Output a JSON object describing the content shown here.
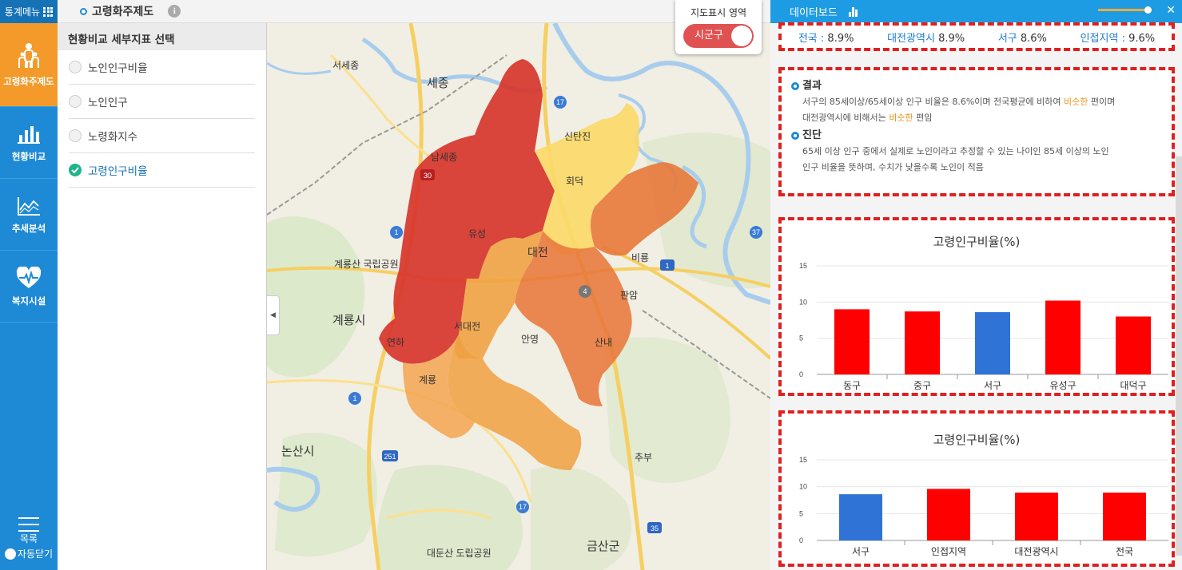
{
  "left_menu": {
    "menu_label": "통계메뉴",
    "items": [
      {
        "label": "고령화주제도",
        "icon": "people-icon",
        "active": true
      },
      {
        "label": "현황비교",
        "icon": "bar-chart-icon",
        "active": false
      },
      {
        "label": "추세분석",
        "icon": "line-chart-icon",
        "active": false
      },
      {
        "label": "복지시설",
        "icon": "heart-pulse-icon",
        "active": false
      }
    ],
    "list_label": "목록",
    "auto_close_label": "자동닫기"
  },
  "topbar": {
    "title": "고령화주제도",
    "info_icon": "i"
  },
  "indicator_panel": {
    "heading": "현황비교 세부지표 선택",
    "options": [
      {
        "label": "노인인구비율",
        "selected": false
      },
      {
        "label": "노인인구",
        "selected": false
      },
      {
        "label": "노령화지수",
        "selected": false
      },
      {
        "label": "고령인구비율",
        "selected": true
      }
    ]
  },
  "map": {
    "toggle_title": "지도표시 영역",
    "toggle_value": "시군구",
    "place_labels": [
      "세종",
      "서세종",
      "남세종",
      "유성",
      "대전",
      "신탄진",
      "회덕",
      "비룡",
      "판암",
      "서대전",
      "안영",
      "산내",
      "연하",
      "계룡",
      "추부",
      "금산군",
      "계룡산 국립공원",
      "계룡시",
      "논산시",
      "대둔산 도립공원"
    ],
    "route_labels": [
      "17",
      "1",
      "37",
      "1",
      "4",
      "251",
      "17",
      "35",
      "30",
      "1"
    ],
    "colors": {
      "red": "#d7352d",
      "light_yellow": "#fbd96a",
      "orange": "#f0a040",
      "dark_orange": "#e8783a",
      "light_orange": "#f3a450"
    }
  },
  "dashboard": {
    "title": "데이터보드",
    "stats": [
      {
        "label": "전국",
        "sep": " : ",
        "value": "8.9%"
      },
      {
        "label": "대전광역시",
        "sep": " ",
        "value": "8.9%"
      },
      {
        "label": "서구",
        "sep": " ",
        "value": "8.6%"
      },
      {
        "label": "인접지역",
        "sep": " : ",
        "value": "9.6%"
      }
    ],
    "result": {
      "heading": "결과",
      "text_1": "서구의 85세이상/65세이상 인구 비율은 8.6%이며 전국평균에 비하여 ",
      "highlight_1": "비슷한",
      "text_2": " 편이며",
      "text_3": "대전광역시에 비해서는 ",
      "highlight_2": "비슷한",
      "text_4": " 편임"
    },
    "diagnosis": {
      "heading": "진단",
      "line_1": "65세 이상 인구 중에서 실제로 노인이라고 추정할 수 있는 나이인 85세 이상의 노인",
      "line_2": "인구 비율을 뜻하며, 수치가 낮을수록 노인이 적음"
    }
  },
  "chart_data": [
    {
      "type": "bar",
      "title": "고령인구비율(%)",
      "categories": [
        "동구",
        "중구",
        "서구",
        "유성구",
        "대덕구"
      ],
      "values": [
        9.0,
        8.7,
        8.6,
        10.2,
        8.0
      ],
      "colors": [
        "#ff0000",
        "#ff0000",
        "#2f73d6",
        "#ff0000",
        "#ff0000"
      ],
      "ylim": [
        0,
        15
      ],
      "yticks": [
        0,
        5,
        10,
        15
      ]
    },
    {
      "type": "bar",
      "title": "고령인구비율(%)",
      "categories": [
        "서구",
        "인접지역",
        "대전광역시",
        "전국"
      ],
      "values": [
        8.6,
        9.6,
        8.9,
        8.9
      ],
      "colors": [
        "#2f73d6",
        "#ff0000",
        "#ff0000",
        "#ff0000"
      ],
      "ylim": [
        0,
        15
      ],
      "yticks": [
        0,
        5,
        10,
        15
      ]
    }
  ]
}
